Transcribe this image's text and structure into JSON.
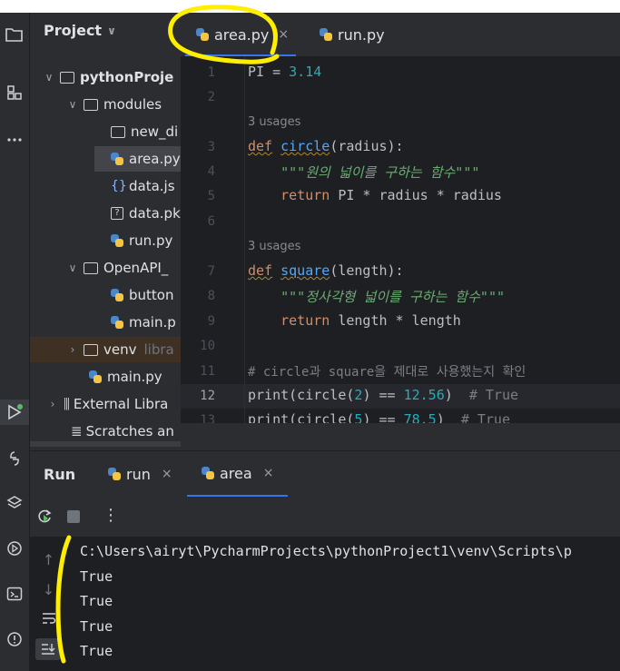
{
  "project_panel": {
    "title": "Project",
    "tree": [
      {
        "label": "pythonProje"
      },
      {
        "label": "modules"
      },
      {
        "label": "new_di"
      },
      {
        "label": "area.py"
      },
      {
        "label": "data.js"
      },
      {
        "label": "data.pk"
      },
      {
        "label": "run.py"
      },
      {
        "label": "OpenAPI_"
      },
      {
        "label": "button"
      },
      {
        "label": "main.p"
      },
      {
        "label": "venv",
        "suffix": "libra"
      },
      {
        "label": "main.py"
      },
      {
        "label": "External Libra"
      },
      {
        "label": "Scratches an"
      }
    ]
  },
  "tabs": [
    {
      "label": "area.py",
      "close": "×"
    },
    {
      "label": "run.py"
    }
  ],
  "editor": {
    "line_numbers": [
      "1",
      "2",
      "3",
      "4",
      "5",
      "6",
      "7",
      "8",
      "9",
      "10",
      "11",
      "12",
      "13"
    ],
    "usages": "3 usages",
    "lines": {
      "l1_a": "PI = ",
      "l1_b": "3.14",
      "l3_kw": "def",
      "l3_fn": "circle",
      "l3_rest": "(radius):",
      "l4": "\"\"\"원의 넓이를 구하는 함수\"\"\"",
      "l5_kw": "return",
      "l5_rest": " PI * radius * radius",
      "l7_kw": "def",
      "l7_fn": "square",
      "l7_rest": "(length):",
      "l8": "\"\"\"정사각형 넓이를 구하는 함수\"\"\"",
      "l9_kw": "return",
      "l9_rest": " length * length",
      "l11": "# circle과 square을 제대로 사용했는지 확인",
      "l12_a": "print(circle(",
      "l12_b": "2",
      "l12_c": ") == ",
      "l12_d": "12.56",
      "l12_e": ")  ",
      "l12_f": "# True",
      "l13_a": "print(circle(",
      "l13_b": "5",
      "l13_c": ") == ",
      "l13_d": "78.5",
      "l13_e": ")  ",
      "l13_f": "# True"
    }
  },
  "run_panel": {
    "title": "Run",
    "tabs": [
      {
        "label": "run",
        "close": "×"
      },
      {
        "label": "area",
        "close": "×"
      }
    ],
    "toolbar_more": "⋮",
    "output": [
      "C:\\Users\\airyt\\PycharmProjects\\pythonProject1\\venv\\Scripts\\p",
      "True",
      "True",
      "True",
      "True"
    ]
  },
  "colors": {
    "background": "#1e1f22",
    "panel": "#2b2d30",
    "keyword": "#cf8e6d",
    "function": "#56a8f5",
    "number": "#2aacb8",
    "string": "#6aab73",
    "annotation": "#ffee00"
  }
}
